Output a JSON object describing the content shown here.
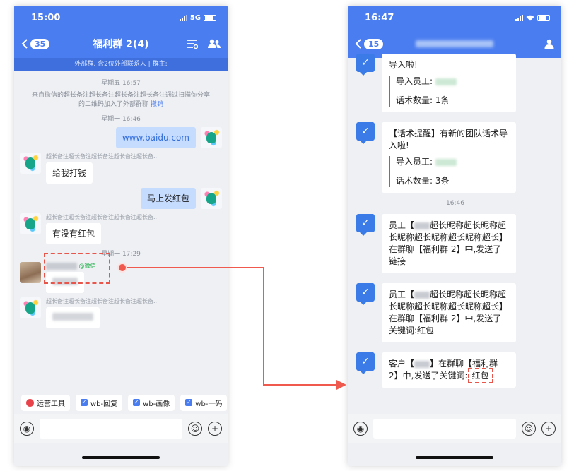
{
  "left_phone": {
    "status_time": "15:00",
    "network": "5G",
    "back_count": "35",
    "title": "福利群 2(4)",
    "subbar": "外部群, 含2位外部联系人 | 群主:",
    "messages": {
      "sep1": "星期五 16:57",
      "sys": "来自微信的超长备注超长备注超长备注超长备注通过扫描你分享的二维码加入了外部群聊",
      "sys_link": "撤销",
      "sep2": "星期一 16:46",
      "me1": "www.baidu.com",
      "sender1": "超长备注超长备注超长备注超长备注超长备...",
      "m1": "给我打钱",
      "me2": "马上发红包",
      "sender2": "超长备注超长备注超长备注超长备注超长备...",
      "m2": "有没有红包",
      "sep3": "星期一 17:29",
      "sender3_tag": "@微信",
      "sender4": "超长备注超长备注超长备注超长备注超长备..."
    },
    "toolbar": {
      "ops": "运营工具",
      "chip1": "wb-回复",
      "chip2": "wb-画像",
      "chip3": "wb-一码"
    }
  },
  "right_phone": {
    "status_time": "16:47",
    "back_count": "15",
    "card1": {
      "title": "导入啦!",
      "employee_label": "导入员工:",
      "count_label": "话术数量:",
      "count_value": "1条"
    },
    "card2": {
      "title": "【话术提醒】有新的团队话术导入啦!",
      "employee_label": "导入员工:",
      "count_label": "话术数量:",
      "count_value": "3条"
    },
    "sep": "16:46",
    "card3": {
      "pre": "员工【",
      "post": "超长昵称超长昵称超长昵称超长昵称超长昵称超长】在群聊【福利群 2】中,发送了链接"
    },
    "card4": {
      "pre": "员工【",
      "post": "超长昵称超长昵称超长昵称超长昵称超长昵称超长】在群聊【福利群 2】中,发送了关键词:红包"
    },
    "card5": {
      "pre": "客户【",
      "mid": "】在群聊【福利群 2】中,发送了关键词:",
      "keyword": "红包"
    }
  },
  "colors": {
    "accent": "#4a7df0",
    "highlight": "#e8564b"
  }
}
